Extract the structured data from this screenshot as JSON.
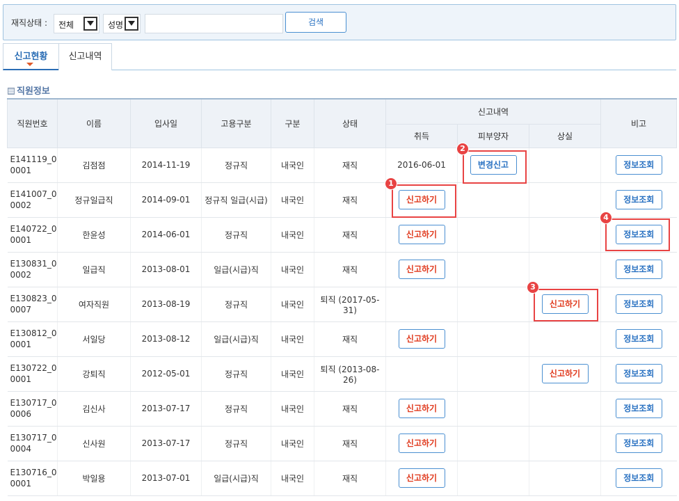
{
  "search": {
    "status_label": "재직상태 :",
    "status_value": "전체",
    "field_value": "성명",
    "keyword_value": "",
    "button_label": "검색"
  },
  "tabs": [
    {
      "label": "신고현황",
      "active": true
    },
    {
      "label": "신고내역",
      "active": false
    }
  ],
  "section_title": "직원정보",
  "columns": {
    "emp_no": "직원번호",
    "name": "이름",
    "join_date": "입사일",
    "employment_type": "고용구분",
    "category": "구분",
    "status": "상태",
    "report_group": "신고내역",
    "acquire": "취득",
    "dependent": "피부양자",
    "loss": "상실",
    "note": "비고"
  },
  "rows": [
    {
      "emp_no": "E141119_00001",
      "name": "김점점",
      "join_date": "2014-11-19",
      "employment_type": "정규직",
      "category": "내국인",
      "status": "재직",
      "acquire": "2016-06-01",
      "dependent": "변경신고",
      "loss": "",
      "note": "정보조회"
    },
    {
      "emp_no": "E141007_00002",
      "name": "정규일급직",
      "join_date": "2014-09-01",
      "employment_type": "정규직 일급(시급)",
      "category": "내국인",
      "status": "재직",
      "acquire": "신고하기",
      "dependent": "",
      "loss": "",
      "note": "정보조회"
    },
    {
      "emp_no": "E140722_00001",
      "name": "한윤성",
      "join_date": "2014-06-01",
      "employment_type": "정규직",
      "category": "내국인",
      "status": "재직",
      "acquire": "신고하기",
      "dependent": "",
      "loss": "",
      "note": "정보조회"
    },
    {
      "emp_no": "E130831_00002",
      "name": "일급직",
      "join_date": "2013-08-01",
      "employment_type": "일급(시급)직",
      "category": "내국인",
      "status": "재직",
      "acquire": "신고하기",
      "dependent": "",
      "loss": "",
      "note": "정보조회"
    },
    {
      "emp_no": "E130823_00007",
      "name": "여자직원",
      "join_date": "2013-08-19",
      "employment_type": "정규직",
      "category": "내국인",
      "status": "퇴직 (2017-05-31)",
      "acquire": "",
      "dependent": "",
      "loss": "신고하기",
      "note": "정보조회"
    },
    {
      "emp_no": "E130812_00001",
      "name": "서일당",
      "join_date": "2013-08-12",
      "employment_type": "일급(시급)직",
      "category": "내국인",
      "status": "재직",
      "acquire": "신고하기",
      "dependent": "",
      "loss": "",
      "note": "정보조회"
    },
    {
      "emp_no": "E130722_00001",
      "name": "강퇴직",
      "join_date": "2012-05-01",
      "employment_type": "정규직",
      "category": "내국인",
      "status": "퇴직 (2013-08-26)",
      "acquire": "",
      "dependent": "",
      "loss": "신고하기",
      "note": "정보조회"
    },
    {
      "emp_no": "E130717_00006",
      "name": "김신사",
      "join_date": "2013-07-17",
      "employment_type": "정규직",
      "category": "내국인",
      "status": "재직",
      "acquire": "신고하기",
      "dependent": "",
      "loss": "",
      "note": "정보조회"
    },
    {
      "emp_no": "E130717_00004",
      "name": "신사원",
      "join_date": "2013-07-17",
      "employment_type": "정규직",
      "category": "내국인",
      "status": "재직",
      "acquire": "신고하기",
      "dependent": "",
      "loss": "",
      "note": "정보조회"
    },
    {
      "emp_no": "E130716_00001",
      "name": "박일용",
      "join_date": "2013-07-01",
      "employment_type": "일급(시급)직",
      "category": "내국인",
      "status": "재직",
      "acquire": "신고하기",
      "dependent": "",
      "loss": "",
      "note": "정보조회"
    }
  ],
  "callouts": [
    "1",
    "2",
    "3",
    "4"
  ],
  "colors": {
    "accent": "#2a72c2",
    "report_text": "#e03a1e",
    "callout": "#e84343",
    "header_bg": "#eef2f7"
  }
}
